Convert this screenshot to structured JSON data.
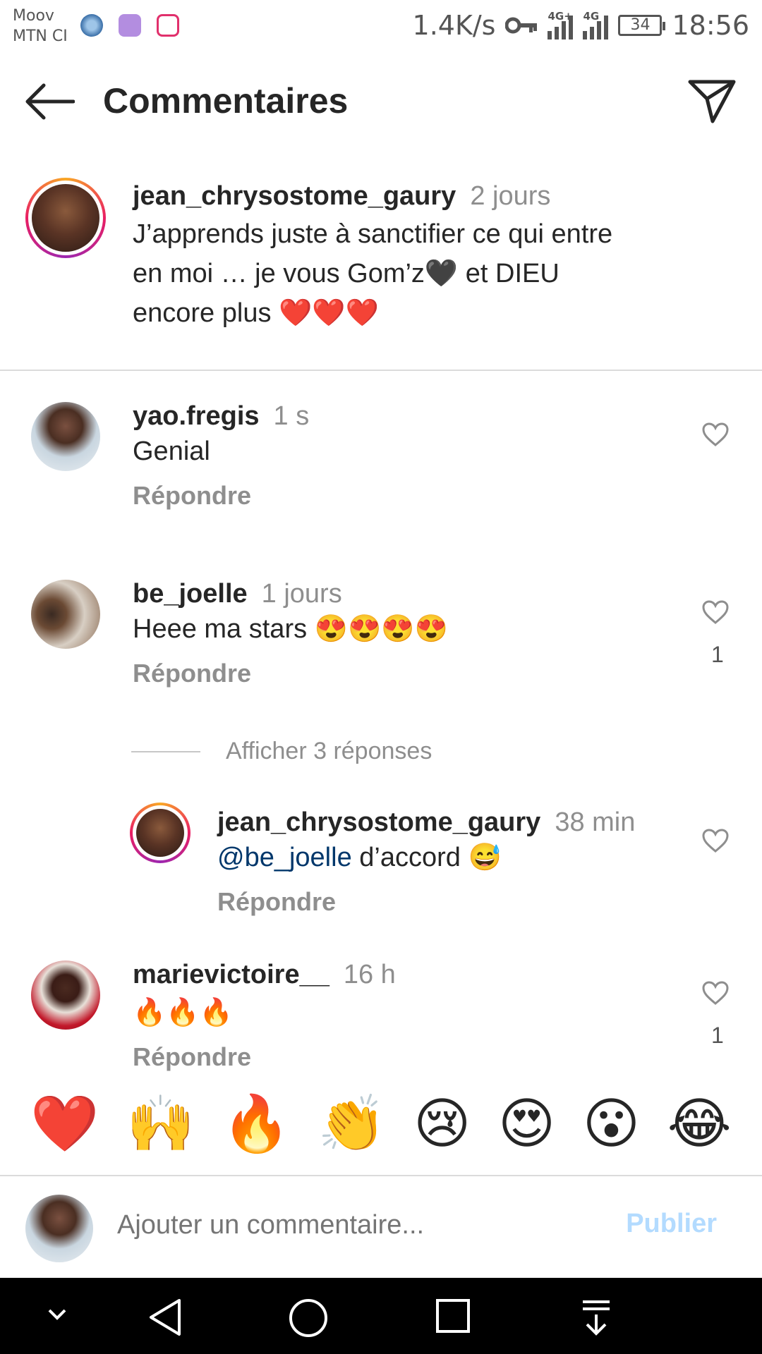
{
  "status_bar": {
    "carrier_line1": "Moov",
    "carrier_line2": "MTN CI",
    "speed": "1.4K/s",
    "net1": "4G+",
    "net2": "4G",
    "battery": "34",
    "time": "18:56"
  },
  "header": {
    "title": "Commentaires"
  },
  "caption": {
    "username": "jean_chrysostome_gaury",
    "time": "2 jours",
    "text_line1": "J’apprends juste à sanctifier ce qui entre",
    "text_line2": "en moi … je vous Gom’z🖤 et DIEU",
    "text_line3": "encore plus ❤️❤️❤️"
  },
  "comments": [
    {
      "username": "yao.fregis",
      "time": "1 s",
      "text": "Genial",
      "reply_label": "Répondre",
      "likes": ""
    },
    {
      "username": "be_joelle",
      "time": "1 jours",
      "text": "Heee ma stars 😍😍😍😍",
      "reply_label": "Répondre",
      "likes": "1"
    },
    {
      "username": "marievictoire__",
      "time": "16 h",
      "text": "🔥🔥🔥",
      "reply_label": "Répondre",
      "likes": "1"
    }
  ],
  "view_replies": "Afficher 3 réponses",
  "reply": {
    "username": "jean_chrysostome_gaury",
    "time": "38 min",
    "mention": "@be_joelle",
    "text": " d’accord 😅",
    "reply_label": "Répondre"
  },
  "emoji_bar": [
    "❤️",
    "🙌",
    "🔥",
    "👏",
    "😢",
    "😍",
    "😮",
    "😂"
  ],
  "input": {
    "placeholder": "Ajouter un commentaire...",
    "publish_label": "Publier"
  },
  "colors": {
    "link": "#00376b",
    "muted": "#8e8e8e",
    "publish_disabled": "#b3dbff"
  }
}
